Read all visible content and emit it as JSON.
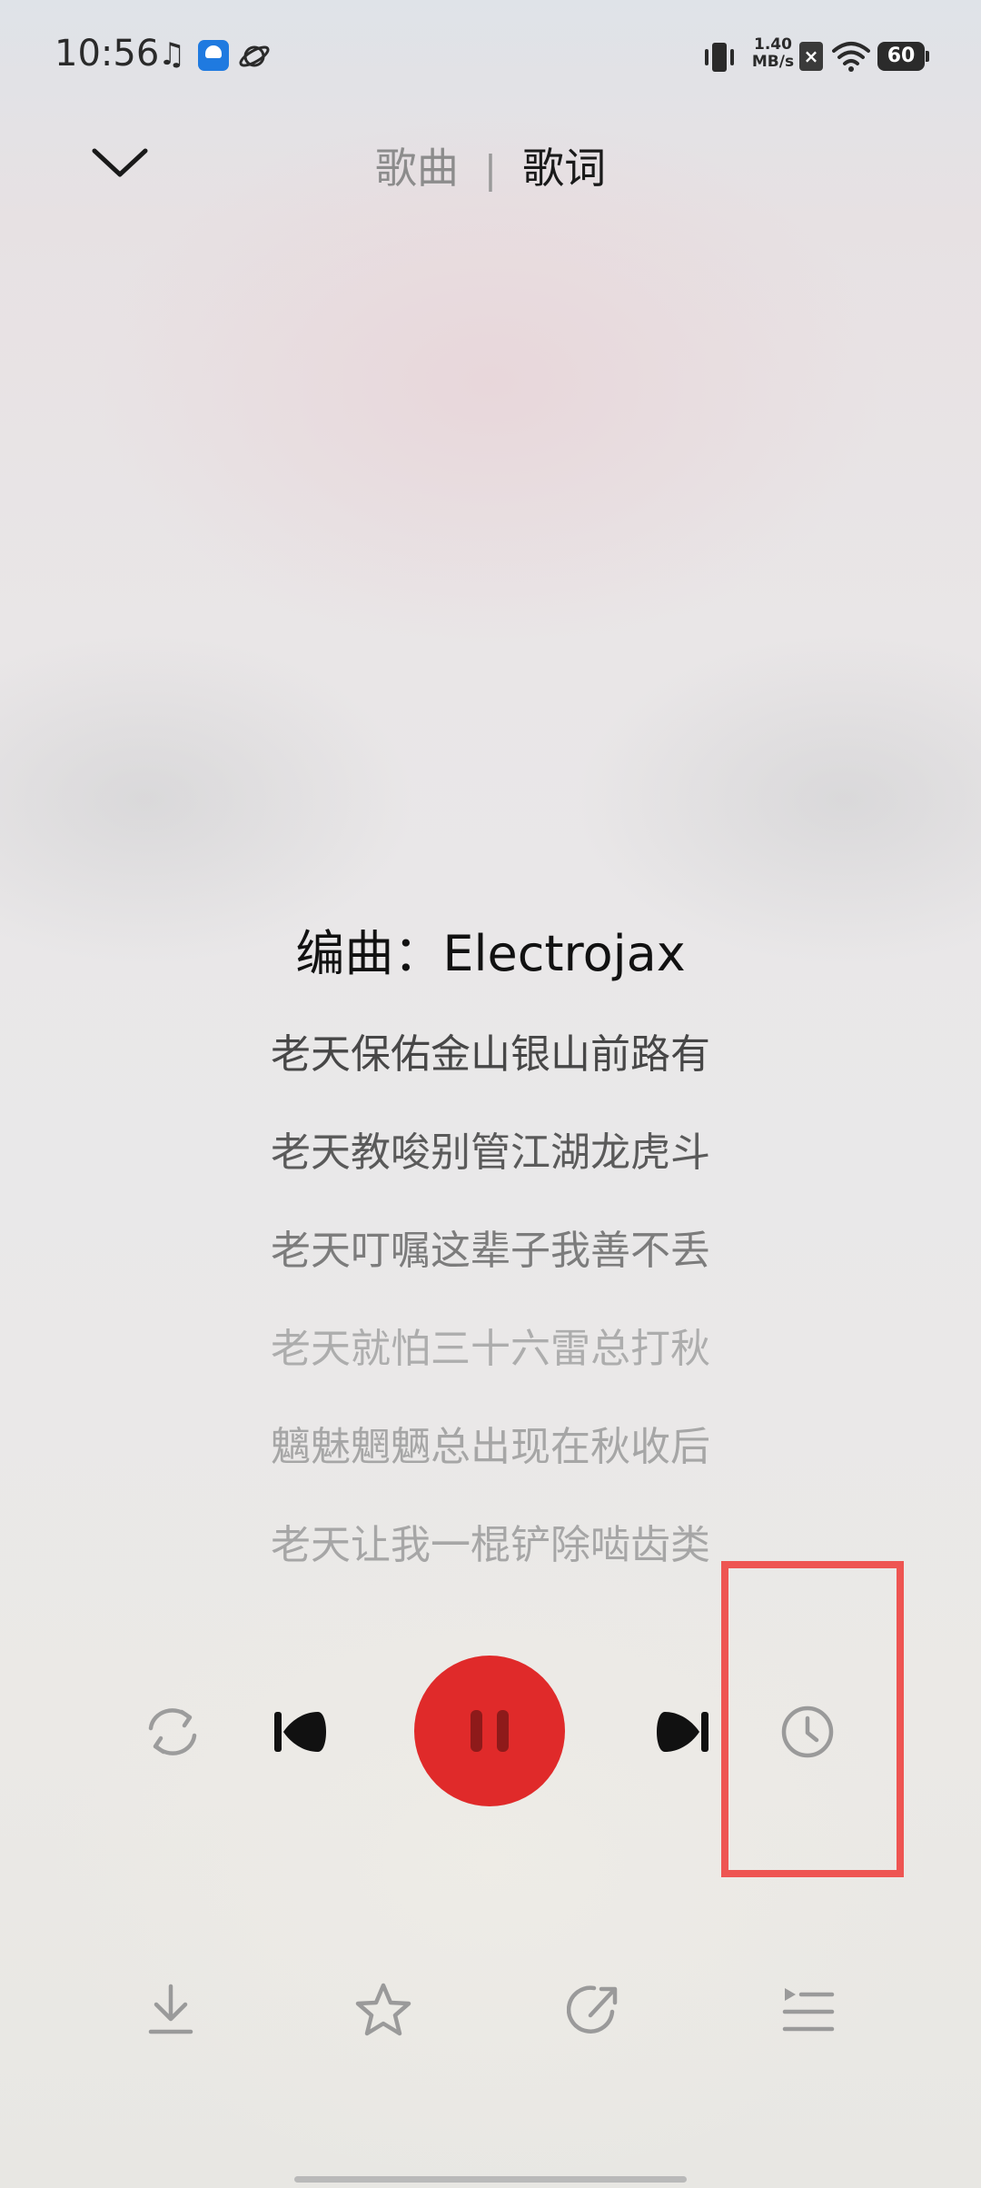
{
  "status_bar": {
    "time": "10:56",
    "network_speed_value": "1.40",
    "network_speed_unit": "MB/s",
    "battery": "60"
  },
  "header": {
    "tab_song": "歌曲",
    "separator": "|",
    "tab_lyrics": "歌词",
    "active_tab": "歌词"
  },
  "lyrics": {
    "lines": [
      "编曲：Electrojax",
      "老天保佑金山银山前路有",
      "老天教唆别管江湖龙虎斗",
      "老天叮嘱这辈子我善不丢",
      "老天就怕三十六雷总打秋",
      "魑魅魍魉总出现在秋收后",
      "老天让我一棍铲除啮齿类"
    ],
    "active_index": 0
  },
  "controls": {
    "repeat_icon": "repeat-icon",
    "previous_icon": "previous-icon",
    "play_state": "playing",
    "next_icon": "next-icon",
    "timer_icon": "clock-icon"
  },
  "toolbar": {
    "download_icon": "download-icon",
    "favorite_icon": "star-icon",
    "share_icon": "share-icon",
    "playlist_icon": "playlist-icon"
  },
  "colors": {
    "accent": "#e02a2a",
    "highlight_box": "#ee5552"
  }
}
